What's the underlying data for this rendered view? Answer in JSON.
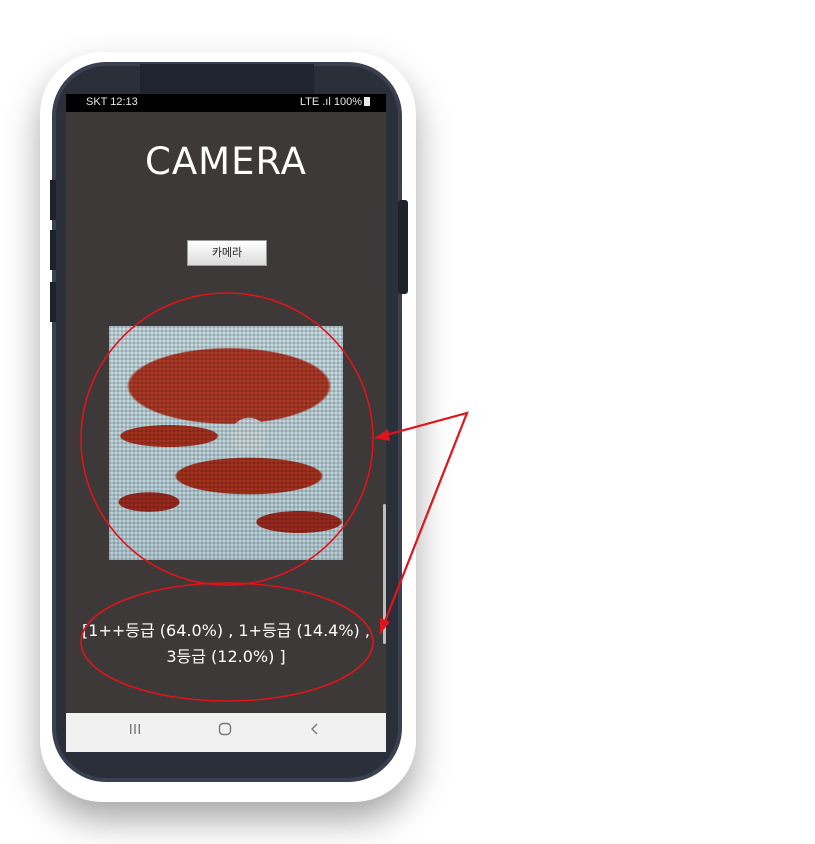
{
  "status_bar": {
    "carrier_time": "SKT 12:13",
    "signal_battery": "LTE .ıl 100%"
  },
  "app": {
    "title": "CAMERA",
    "camera_button_label": "카메라"
  },
  "result": {
    "line1": "[1++등급 (64.0%) , 1+등급 (14.4%) ,",
    "line2": "3등급 (12.0%) ]"
  },
  "navbar": {
    "recent_icon": "recent-apps-icon",
    "home_icon": "home-icon",
    "back_icon": "back-icon"
  },
  "colors": {
    "screen_bg": "#3d3938",
    "annotation": "#e0141a"
  }
}
